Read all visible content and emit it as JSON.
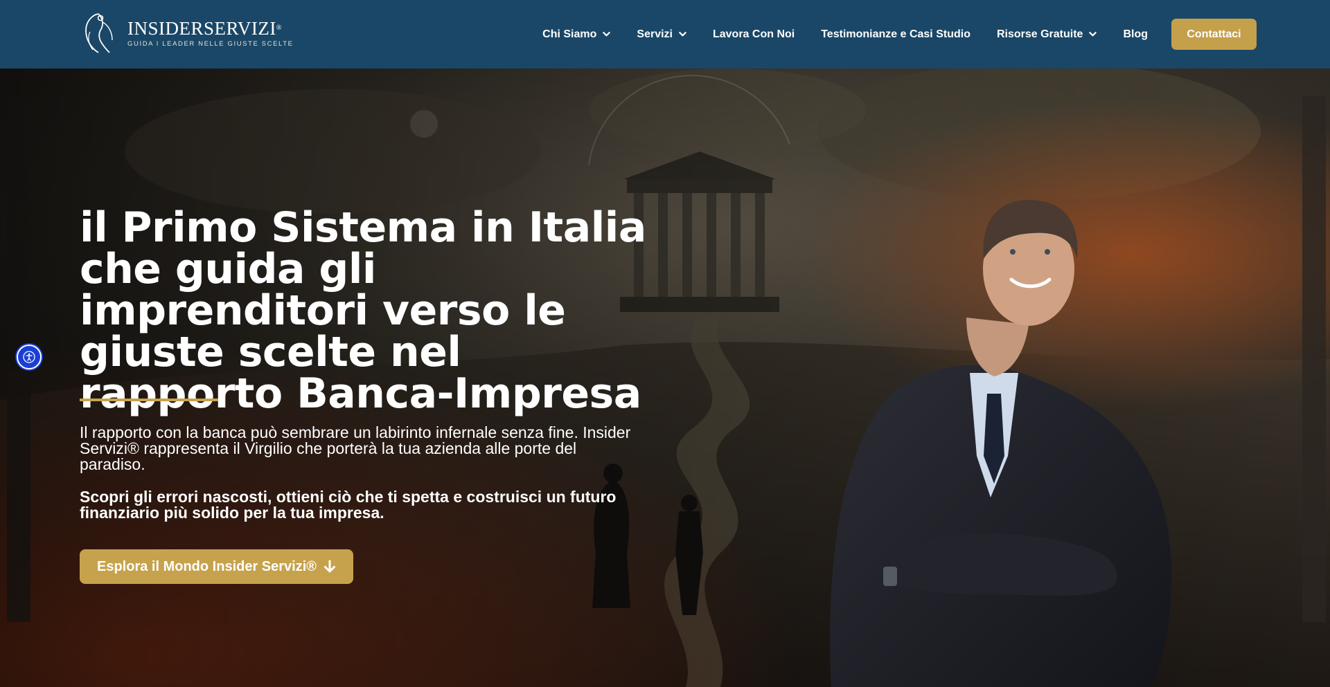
{
  "brand": {
    "name": "INSIDERSERVIZI",
    "registered": "®",
    "tagline": "GUIDA I LEADER NELLE GIUSTE SCELTE"
  },
  "nav": {
    "items": [
      {
        "label": "Chi Siamo",
        "dropdown": true
      },
      {
        "label": "Servizi",
        "dropdown": true
      },
      {
        "label": "Lavora Con Noi",
        "dropdown": false
      },
      {
        "label": "Testimonianze e Casi Studio",
        "dropdown": false
      },
      {
        "label": "Risorse Gratuite",
        "dropdown": true
      },
      {
        "label": "Blog",
        "dropdown": false
      }
    ],
    "cta_label": "Contattaci"
  },
  "hero": {
    "title": "il Primo Sistema in Italia che guida gli imprenditori verso le giuste scelte nel rapporto Banca-Impresa",
    "paragraph": "Il rapporto con la banca può sembrare un labirinto infernale senza fine. Insider Servizi® rappresenta il Virgilio che porterà la tua azienda alle porte del paradiso.",
    "paragraph_bold": "Scopri gli errori nascosti, ottieni ciò che ti spetta e costruisci un futuro finanziario più solido per la tua impresa.",
    "cta_label": "Esplora il Mondo Insider Servizi®"
  },
  "colors": {
    "header_bg": "#1a4767",
    "gold": "#c6a24d",
    "accessibility_blue": "#1a3fd6"
  },
  "icons": {
    "accessibility": "accessibility-icon",
    "dropdown": "chevron-down-icon",
    "cta": "arrow-down-icon"
  }
}
